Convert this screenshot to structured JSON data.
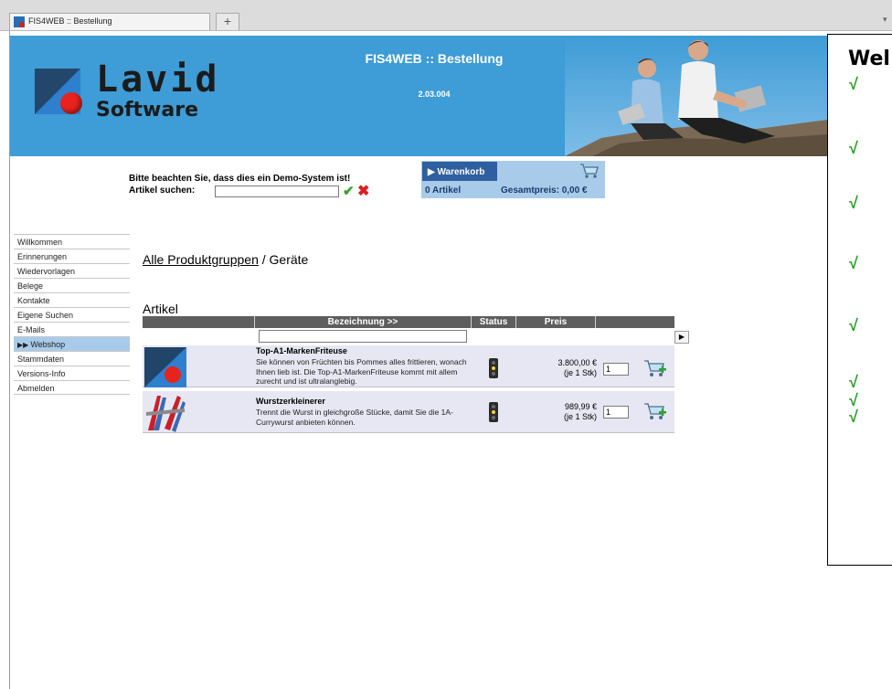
{
  "browser": {
    "tab_title": "FIS4WEB :: Bestellung",
    "new_tab_label": "+"
  },
  "banner": {
    "logo_line1": "Lavid",
    "logo_line2": "Software",
    "title": "FIS4WEB :: Bestellung",
    "version": "2.03.004"
  },
  "search": {
    "demo_notice": "Bitte beachten Sie, dass dies ein Demo-System ist!",
    "label": "Artikel suchen:",
    "value": ""
  },
  "cart": {
    "button_label": "Warenkorb",
    "count": "0 Artikel",
    "total": "Gesamtpreis: 0,00 €"
  },
  "sidebar": {
    "items": [
      {
        "label": "Willkommen",
        "active": false
      },
      {
        "label": "Erinnerungen",
        "active": false
      },
      {
        "label": "Wiedervorlagen",
        "active": false
      },
      {
        "label": "Belege",
        "active": false
      },
      {
        "label": "Kontakte",
        "active": false
      },
      {
        "label": "Eigene Suchen",
        "active": false
      },
      {
        "label": "E-Mails",
        "active": false
      },
      {
        "label": "Webshop",
        "active": true
      },
      {
        "label": "Stammdaten",
        "active": false
      },
      {
        "label": "Versions-Info",
        "active": false
      },
      {
        "label": "Abmelden",
        "active": false
      }
    ]
  },
  "breadcrumb": {
    "link": "Alle Produktgruppen",
    "separator": " / ",
    "current": "Geräte"
  },
  "articles": {
    "heading": "Artikel",
    "columns": {
      "name": "Bezeichnung >>",
      "status": "Status",
      "price": "Preis"
    },
    "filter_value": "",
    "rows": [
      {
        "name": "Top-A1-MarkenFriteuse",
        "description": "Sie können von Früchten bis Pommes alles frittieren, wonach Ihnen lieb ist. Die Top-A1-MarkenFriteuse kommt mit allem zurecht und ist ultralanglebig.",
        "price": "3.800,00 €",
        "unit": "(je 1 Stk)",
        "qty": "1"
      },
      {
        "name": "Wurstzerkleinerer",
        "description": "Trennt die Wurst in gleichgroße Stücke, damit Sie die 1A-Currywurst anbieten können.",
        "price": "989,99 €",
        "unit": "(je 1 Stk)",
        "qty": "1"
      }
    ]
  },
  "infobox": {
    "title": "Wel"
  },
  "colors": {
    "banner": "#3e9cd6",
    "cart_bg": "#a9cbea",
    "cart_button": "#2f5fa0",
    "table_header": "#5e5e5e",
    "row_bg": "#e7e7f3",
    "check": "#22a11e"
  }
}
